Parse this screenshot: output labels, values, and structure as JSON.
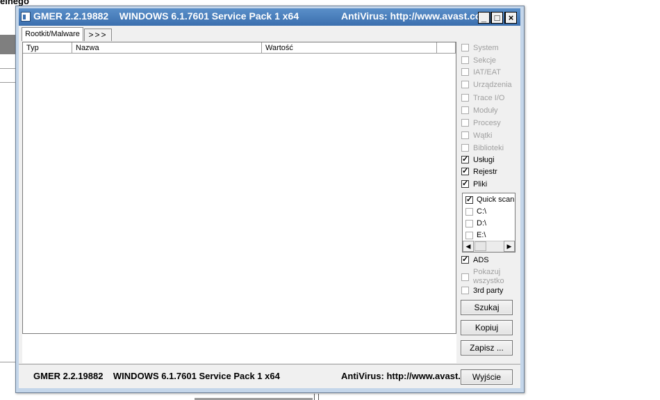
{
  "background": {
    "partial_text": "elnego"
  },
  "window": {
    "title_app": "GMER 2.2.19882",
    "title_os": "WINDOWS 6.1.7601 Service Pack 1 x64",
    "title_av": "AntiVirus: http://www.avast.com",
    "controls": {
      "minimize": "_",
      "maximize": "□",
      "close": "×"
    }
  },
  "tabs": [
    {
      "label": "Rootkit/Malware"
    },
    {
      "label": ">>>"
    }
  ],
  "list": {
    "columns": [
      "Typ",
      "Nazwa",
      "Wartość"
    ]
  },
  "options": [
    {
      "label": "System",
      "checked": false,
      "enabled": false
    },
    {
      "label": "Sekcje",
      "checked": false,
      "enabled": false
    },
    {
      "label": "IAT/EAT",
      "checked": false,
      "enabled": false
    },
    {
      "label": "Urządzenia",
      "checked": false,
      "enabled": false
    },
    {
      "label": "Trace I/O",
      "checked": false,
      "enabled": false
    },
    {
      "label": "Moduły",
      "checked": false,
      "enabled": false
    },
    {
      "label": "Procesy",
      "checked": false,
      "enabled": false
    },
    {
      "label": "Wątki",
      "checked": false,
      "enabled": false
    },
    {
      "label": "Biblioteki",
      "checked": false,
      "enabled": false
    },
    {
      "label": "Usługi",
      "checked": true,
      "enabled": true
    },
    {
      "label": "Rejestr",
      "checked": true,
      "enabled": true
    },
    {
      "label": "Pliki",
      "checked": true,
      "enabled": true
    }
  ],
  "drives": [
    {
      "label": "Quick scan",
      "checked": true
    },
    {
      "label": "C:\\",
      "checked": false
    },
    {
      "label": "D:\\",
      "checked": false
    },
    {
      "label": "E:\\",
      "checked": false
    }
  ],
  "extra_options": [
    {
      "label": "ADS",
      "checked": true,
      "enabled": true
    },
    {
      "label": "Pokazuj wszystko",
      "checked": false,
      "enabled": false
    },
    {
      "label": "3rd party",
      "checked": false,
      "enabled": true
    }
  ],
  "buttons": {
    "scan": "Szukaj",
    "copy": "Kopiuj",
    "save": "Zapisz ...",
    "exit": "Wyjście"
  },
  "status": {
    "app": "GMER 2.2.19882",
    "os": "WINDOWS 6.1.7601 Service Pack 1 x64",
    "av": "AntiVirus: http://www.avast.com"
  }
}
